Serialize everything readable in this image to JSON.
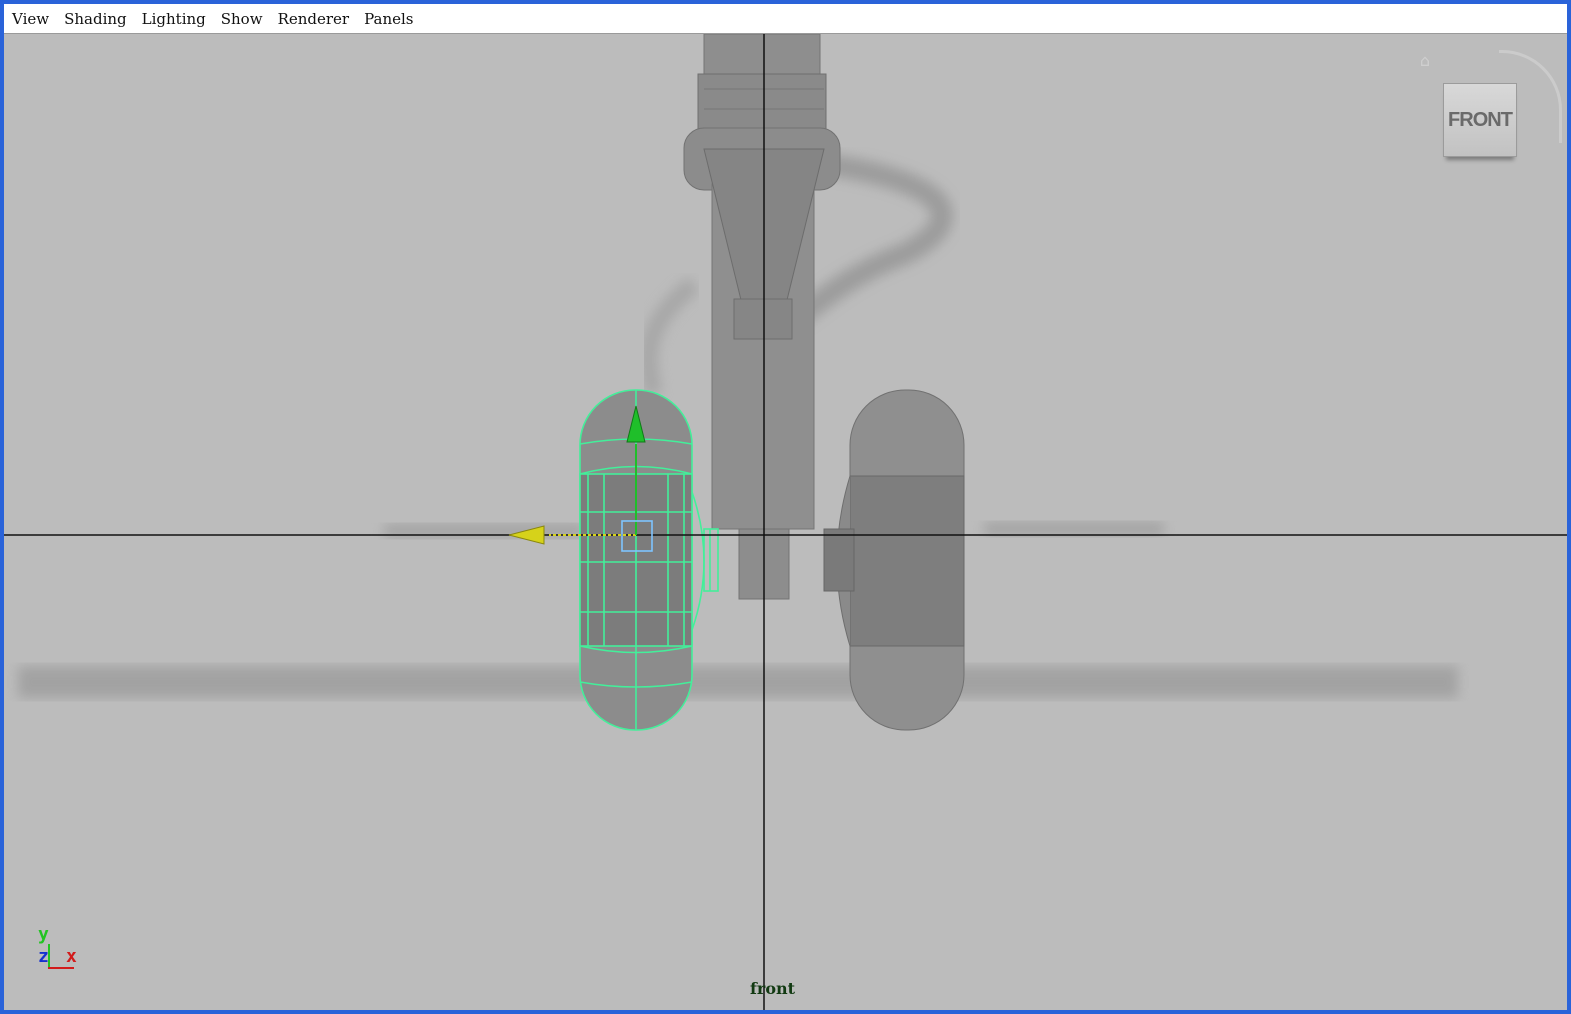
{
  "menubar": {
    "items": [
      "View",
      "Shading",
      "Lighting",
      "Show",
      "Renderer",
      "Panels"
    ]
  },
  "viewcube": {
    "face_label": "FRONT"
  },
  "axis_indicator": {
    "y": "y",
    "z": "z",
    "x": "x"
  },
  "viewport": {
    "camera_name": "front"
  },
  "colors": {
    "background": "#bcbcbc",
    "selection_wire": "#43ef9a",
    "grid_axis": "#111111",
    "move_x_arrow": "#d6d21a",
    "move_y_arrow": "#1fbf2a",
    "frame": "#2a63d9"
  },
  "icons": [
    "home-icon",
    "viewcube",
    "axis-indicator",
    "move-manipulator"
  ]
}
